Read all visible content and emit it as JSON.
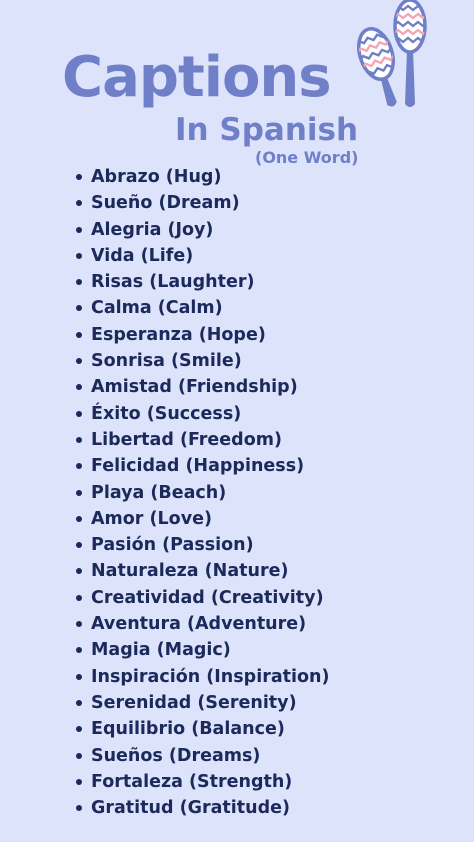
{
  "header": {
    "title": "Captions",
    "subtitle": "In Spanish",
    "note": "(One Word)"
  },
  "colors": {
    "background": "#dde3fb",
    "accent": "#6f7fc8",
    "text": "#1b2a5a"
  },
  "decoration": {
    "icon": "maracas-icon"
  },
  "items": [
    "Abrazo (Hug)",
    "Sueño (Dream)",
    "Alegria (Joy)",
    "Vida (Life)",
    "Risas (Laughter)",
    "Calma (Calm)",
    "Esperanza (Hope)",
    "Sonrisa (Smile)",
    "Amistad (Friendship)",
    "Éxito (Success)",
    "Libertad (Freedom)",
    "Felicidad (Happiness)",
    "Playa (Beach)",
    "Amor (Love)",
    "Pasión (Passion)",
    "Naturaleza (Nature)",
    "Creatividad (Creativity)",
    "Aventura (Adventure)",
    "Magia (Magic)",
    "Inspiración (Inspiration)",
    "Serenidad (Serenity)",
    "Equilibrio (Balance)",
    "Sueños (Dreams)",
    "Fortaleza (Strength)",
    "Gratitud (Gratitude)"
  ]
}
